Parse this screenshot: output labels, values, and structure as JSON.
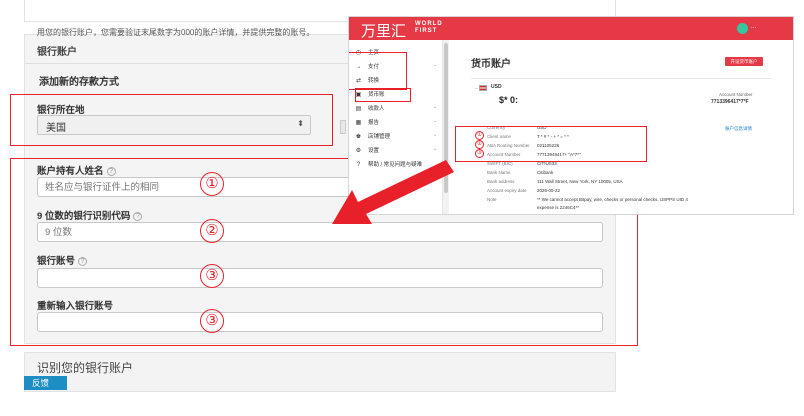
{
  "form": {
    "panel_title": "银行账户",
    "subheading": "添加新的存款方式",
    "country": {
      "label": "银行所在地",
      "value": "美国"
    },
    "holder_name": {
      "label": "账户持有人姓名",
      "placeholder": "姓名应与银行证件上的相同"
    },
    "routing": {
      "label": "9 位数的银行识别代码",
      "placeholder": "9 位数"
    },
    "account": {
      "label": "银行账号"
    },
    "account_confirm": {
      "label": "重新输入银行账号"
    },
    "help_glyph": "?"
  },
  "annotations": {
    "circle_1": "①",
    "circle_2": "②",
    "circle_3": "③",
    "color": "#e8202a"
  },
  "bottom": {
    "title": "识别您的银行账户",
    "note": "用您的银行账户，您需要验证末尾数字为000的账户详情，并提供完整的账号。",
    "feedback": "反馈",
    "feedback_close": "×"
  },
  "worldfirst": {
    "logo_cn": "万里汇",
    "logo_en_line1": "WORLD",
    "logo_en_line2": "FIRST",
    "user": "...",
    "brand_color": "#e63946",
    "nav": [
      {
        "icon": "◷",
        "label": "主页",
        "chevron": ""
      },
      {
        "icon": "→",
        "label": "支付",
        "chevron": "⌄"
      },
      {
        "icon": "⇄",
        "label": "转换",
        "chevron": ""
      },
      {
        "icon": "▣",
        "label": "货币账",
        "chevron": ""
      },
      {
        "icon": "▤",
        "label": "收款人",
        "chevron": "⌄"
      },
      {
        "icon": "▦",
        "label": "报告",
        "chevron": "⌄"
      },
      {
        "icon": "♚",
        "label": "店铺管理",
        "chevron": "⌄"
      },
      {
        "icon": "⚙",
        "label": "设置",
        "chevron": "⌄"
      },
      {
        "icon": "?",
        "label": "帮助 / 常见问题与疑难",
        "chevron": ""
      }
    ],
    "page_title": "货币账户",
    "open_button": "开设货币账户",
    "currency": "USD",
    "balance": "$* 0:",
    "account_number_label": "Account Number",
    "account_number": "7713396417*7*F",
    "details_link": "账户信息详情",
    "rows": [
      {
        "label": "Currency",
        "value": "USD"
      },
      {
        "label": "Client name",
        "value": "T * # * - + * = * *"
      },
      {
        "label": "ABA Routing Number",
        "value": "021105236"
      },
      {
        "label": "Account Number",
        "value": "77713948417+ \"A*7*\""
      },
      {
        "label": "SWIFT (BIC)",
        "value": "CITIUS33"
      },
      {
        "label": "Bank Name",
        "value": "Citibank"
      },
      {
        "label": "Bank address",
        "value": "111 Wall Street, New York, NY 10005, USA"
      },
      {
        "label": "Account expiry date",
        "value": "2026-05-22"
      },
      {
        "label": "Note",
        "value": "** We cannot accept Bitpay, wire, checks or personal checks. USPPS UID 4"
      },
      {
        "label": "",
        "value": "expense is 2246C4**"
      }
    ]
  }
}
